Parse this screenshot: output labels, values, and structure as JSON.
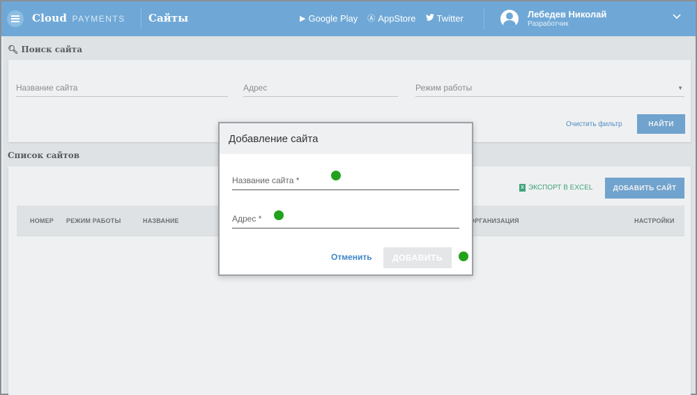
{
  "header": {
    "brand": "Cloud",
    "brand_sub": "PAYMENTS",
    "page_title": "Сайты",
    "links": [
      {
        "label": "Google Play",
        "icon": "play-icon"
      },
      {
        "label": "AppStore",
        "icon": "appstore-icon"
      },
      {
        "label": "Twitter",
        "icon": "twitter-icon"
      }
    ],
    "user_name": "Лебедев Николай",
    "user_role": "Разработчик"
  },
  "search": {
    "title": "Поиск сайта",
    "name_placeholder": "Название сайта",
    "address_placeholder": "Адрес",
    "mode_placeholder": "Режим работы",
    "clear_label": "Очистить фильтр",
    "find_label": "НАЙТИ"
  },
  "list": {
    "title": "Список сайтов",
    "export_label": "ЭКСПОРТ В EXCEL",
    "add_label": "ДОБАВИТЬ САЙТ",
    "columns": [
      "НОМЕР",
      "РЕЖИМ РАБОТЫ",
      "НАЗВАНИЕ",
      "ОРГАНИЗАЦИЯ",
      "НАСТРОЙКИ"
    ]
  },
  "dialog": {
    "title": "Добавление сайта",
    "name_label": "Название сайта  *",
    "address_label": "Адрес *",
    "cancel_label": "Отменить",
    "add_label": "ДОБАВИТЬ"
  },
  "colors": {
    "header_bg": "#6fa8d6",
    "accent": "#4a8fd0",
    "marker": "#22a21c"
  }
}
